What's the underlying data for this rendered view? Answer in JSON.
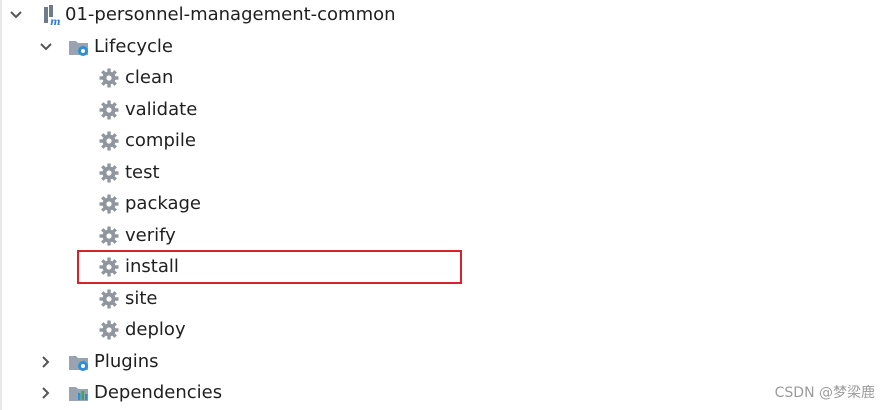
{
  "tree": {
    "root": {
      "label": "01-personnel-management-common",
      "icon": "maven-module-icon",
      "expanded": true
    },
    "lifecycle": {
      "label": "Lifecycle",
      "icon": "folder-gear-icon",
      "expanded": true,
      "items": [
        {
          "label": "clean",
          "icon": "gear-icon"
        },
        {
          "label": "validate",
          "icon": "gear-icon"
        },
        {
          "label": "compile",
          "icon": "gear-icon"
        },
        {
          "label": "test",
          "icon": "gear-icon"
        },
        {
          "label": "package",
          "icon": "gear-icon"
        },
        {
          "label": "verify",
          "icon": "gear-icon"
        },
        {
          "label": "install",
          "icon": "gear-icon",
          "highlighted": true
        },
        {
          "label": "site",
          "icon": "gear-icon"
        },
        {
          "label": "deploy",
          "icon": "gear-icon"
        }
      ]
    },
    "plugins": {
      "label": "Plugins",
      "icon": "folder-gear-icon",
      "expanded": false
    },
    "dependencies": {
      "label": "Dependencies",
      "icon": "dependencies-icon",
      "expanded": false
    }
  },
  "highlight_color": "#d9212b",
  "watermark": "CSDN @梦梁鹿"
}
